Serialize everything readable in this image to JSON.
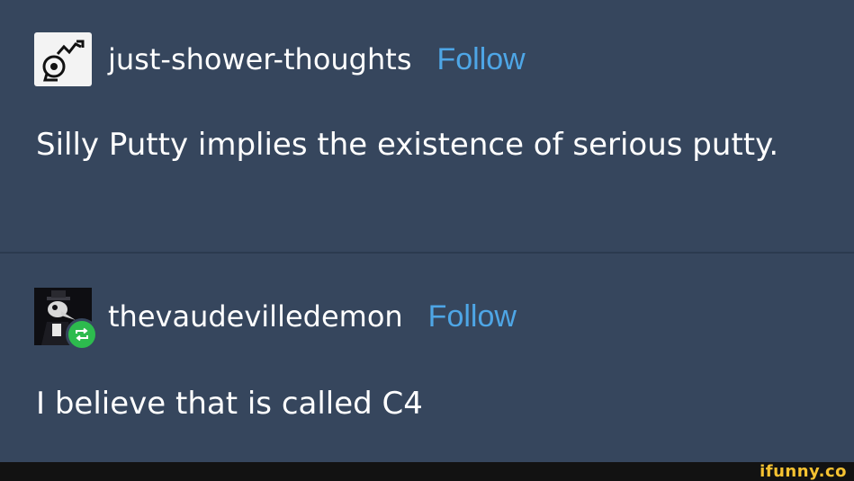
{
  "posts": [
    {
      "username": "just-shower-thoughts",
      "follow_label": "Follow",
      "avatar_icon": "brain-idea-icon",
      "body": "Silly Putty implies the existence of serious putty."
    },
    {
      "username": "thevaudevilledemon",
      "follow_label": "Follow",
      "avatar_icon": "plague-doctor-avatar",
      "badge_icon": "reblog-icon",
      "body": "I believe that is called C4"
    }
  ],
  "colors": {
    "background": "#36465d",
    "follow_link": "#4ea6e6",
    "text": "#ffffff",
    "reblog_badge": "#2dbb4e",
    "watermark": "#f6c231"
  },
  "watermark": "ifunny.co"
}
